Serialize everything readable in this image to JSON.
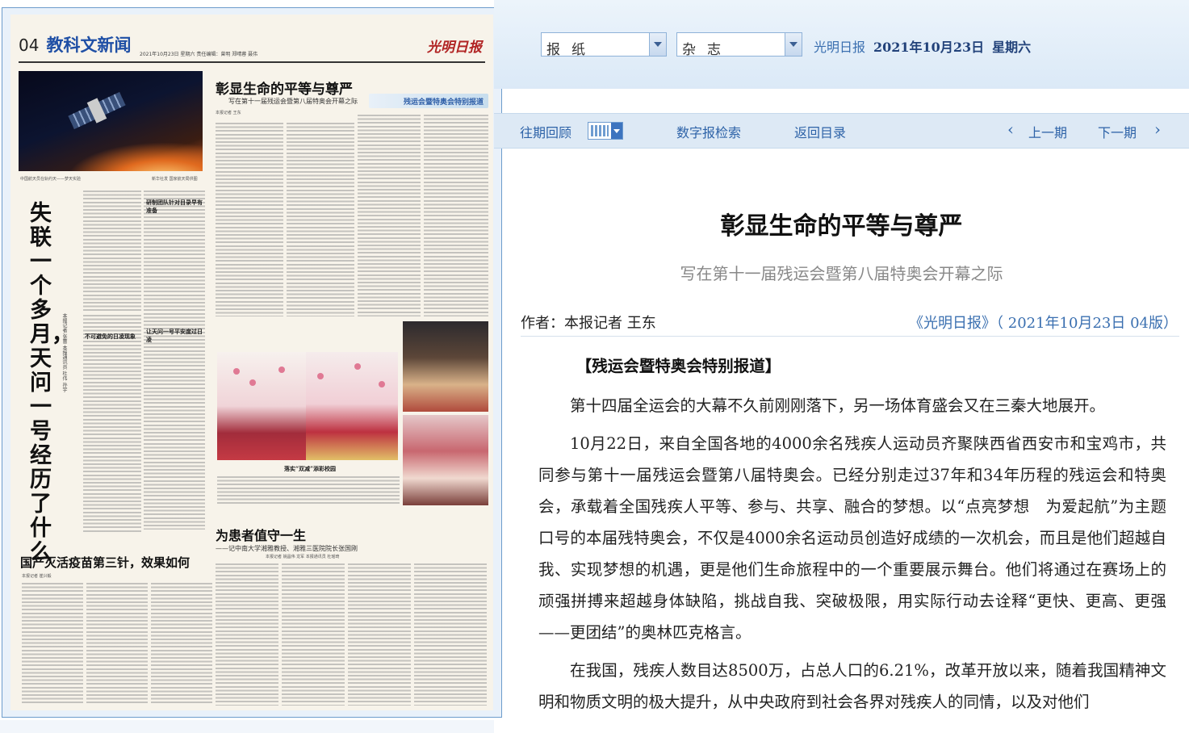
{
  "paper": {
    "page_no": "04",
    "section_title": "教科文新闻",
    "masthead_logo": "光明日报",
    "masthead_meta": "2021年10月23日  星期六  责任编辑：曾明 郑晴蓉 聂伟",
    "hero_caption": "中国航天员在轨约天——梦天实验",
    "hero_credit": "新华社发 国家航天局供图",
    "vertical_headline": "失联一个多月，天问一号经历了什么",
    "vertical_byline": "本报记者 张蕾  本报通讯员 杜伟 孙宇",
    "main_headline": "彰显生命的平等与尊严",
    "main_subhead": "写在第十一届残运会暨第八届特奥会开幕之际",
    "main_byline": "本报记者 王东",
    "badge_text": "残运会暨特奥会特别报道",
    "photo_caption": "落实“双减”添彩校园",
    "sub_head_1": "研制团队针对目录早有准备",
    "sub_head_2": "不可避免的日凌现象",
    "sub_head_3": "让天问一号平安度过日凌",
    "bottom_headline_left": "国产灭活疫苗第三针，效果如何",
    "bottom_byline_left": "本报记者 崔兴毅",
    "bottom_headline_right": "为患者值守一生",
    "bottom_subhead_right": "——记中南大学湘雅教授、湘雅三医院院长张国刚",
    "bottom_byline_right": "本报记者 姚昌伟 龙军  本报通讯员 杜瑶琦"
  },
  "topbar": {
    "select_paper": "报纸",
    "select_magazine": "杂志",
    "paper_name": "光明日报",
    "date": "2021年10月23日",
    "weekday": "星期六"
  },
  "nav": {
    "past_issues": "往期回顾",
    "digital_search": "数字报检索",
    "back_to_toc": "返回目录",
    "prev_issue": "上一期",
    "next_issue": "下一期",
    "prev_arrow": "‹",
    "next_arrow": "›"
  },
  "article": {
    "title": "彰显生命的平等与尊严",
    "subtitle": "写在第十一届残运会暨第八届特奥会开幕之际",
    "author": "作者：本报记者  王东",
    "source": "《光明日报》（ 2021年10月23日   04版）",
    "lead_tag": "【残运会暨特奥会特别报道】",
    "paragraphs": [
      "第十四届全运会的大幕不久前刚刚落下，另一场体育盛会又在三秦大地展开。",
      "10月22日，来自全国各地的4000余名残疾人运动员齐聚陕西省西安市和宝鸡市，共同参与第十一届残运会暨第八届特奥会。已经分别走过37年和34年历程的残运会和特奥会，承载着全国残疾人平等、参与、共享、融合的梦想。以“点亮梦想　为爱起航”为主题口号的本届残特奥会，不仅是4000余名运动员创造好成绩的一次机会，而且是他们超越自我、实现梦想的机遇，更是他们生命旅程中的一个重要展示舞台。他们将通过在赛场上的顽强拼搏来超越身体缺陷，挑战自我、突破极限，用实际行动去诠释“更快、更高、更强——更团结”的奥林匹克格言。",
      "在我国，残疾人数目达8500万，占总人口的6.21%，改革开放以来，随着我国精神文明和物质文明的极大提升，从中央政府到社会各界对残疾人的同情，以及对他们"
    ]
  },
  "colors": {
    "accent_blue": "#2e63a8",
    "title_blue": "#1f4fa5",
    "header_bg": "#dbe9f7"
  }
}
